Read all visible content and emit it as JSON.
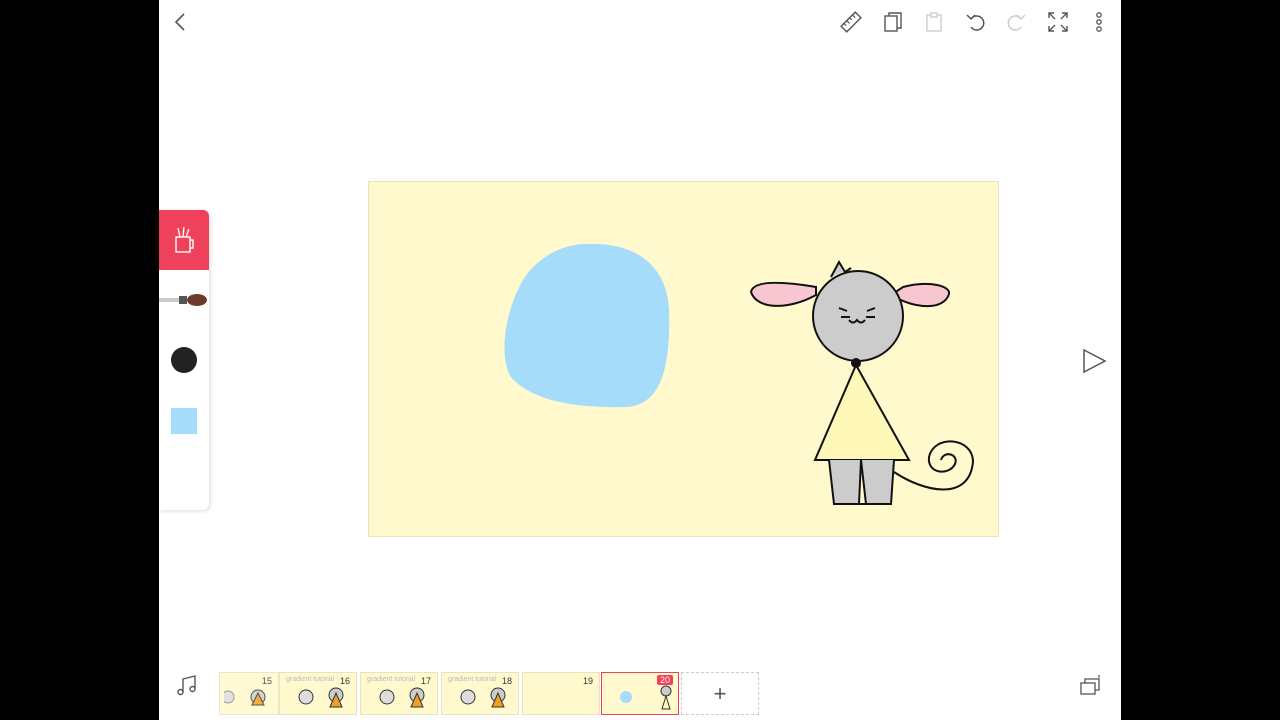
{
  "toolbar": {
    "icons": [
      "back-icon",
      "ruler-icon",
      "copy-icon",
      "paste-icon",
      "undo-icon",
      "redo-icon",
      "fullscreen-icon",
      "more-icon"
    ]
  },
  "colors": {
    "accent": "#f0415a",
    "canvas_bg": "#fff9cd",
    "current_color": "#222222",
    "layer_color": "#a5dcf9"
  },
  "timeline": {
    "frames": [
      {
        "number": "15",
        "has_sketch": true,
        "faded": true
      },
      {
        "number": "16",
        "has_sketch": true
      },
      {
        "number": "17",
        "has_sketch": true
      },
      {
        "number": "18",
        "has_sketch": true
      },
      {
        "number": "19",
        "has_sketch": false
      },
      {
        "number": "20",
        "has_sketch": true,
        "active": true
      }
    ],
    "frame_caption": "gradient tutorial",
    "add_label": "+"
  }
}
